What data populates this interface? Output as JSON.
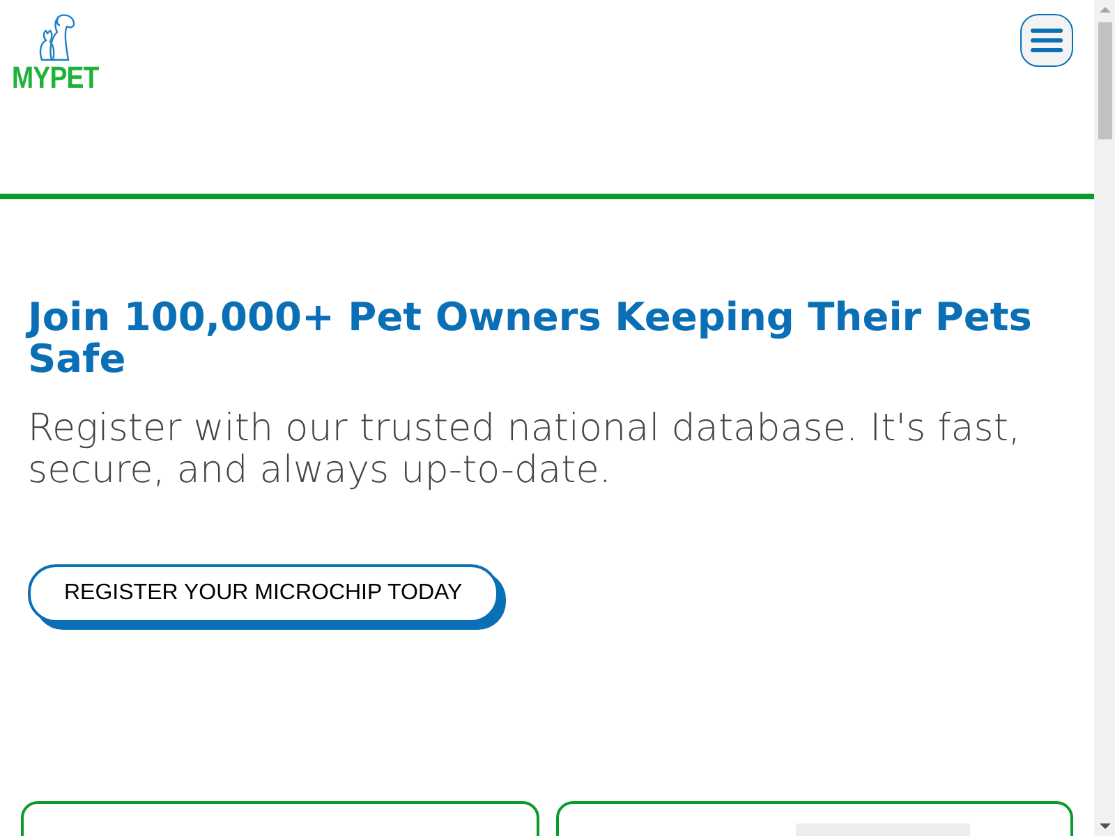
{
  "logo": {
    "text": "MYPET"
  },
  "hero": {
    "title": "Join 100,000+ Pet Owners Keeping Their Pets Safe",
    "subtitle": "Register with our trusted national database. It's fast, secure, and always up-to-date.",
    "button": "REGISTER YOUR MICROCHIP TODAY"
  }
}
